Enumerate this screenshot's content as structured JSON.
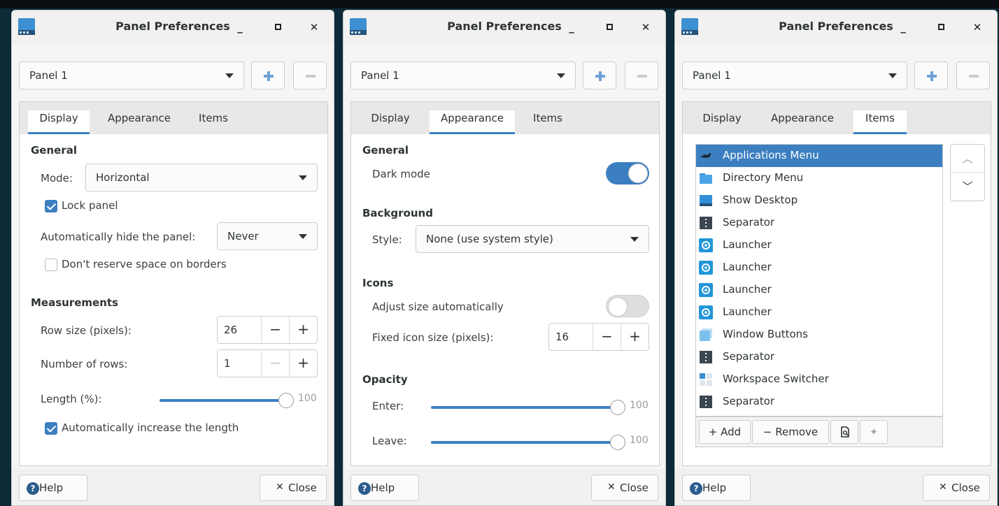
{
  "colors": {
    "accent": "#3c7fc1",
    "window_bg": "#f6f5f4",
    "desktop": "#0c2a38"
  },
  "windows": [
    {
      "title": "Panel Preferences",
      "panel_selected": "Panel 1",
      "tabs": [
        "Display",
        "Appearance",
        "Items"
      ],
      "active_tab": "Display",
      "display": {
        "general_header": "General",
        "mode_label": "Mode:",
        "mode_value": "Horizontal",
        "lock_panel_label": "Lock panel",
        "lock_panel_checked": true,
        "autohide_label": "Automatically hide the panel:",
        "autohide_value": "Never",
        "reserve_label": "Don't reserve space on borders",
        "reserve_checked": false,
        "measurements_header": "Measurements",
        "row_size_label": "Row size (pixels):",
        "row_size_value": "26",
        "rows_label": "Number of rows:",
        "rows_value": "1",
        "length_label": "Length (%):",
        "length_value": "100",
        "auto_length_label": "Automatically increase the length",
        "auto_length_checked": true
      },
      "footer": {
        "help": "Help",
        "close": "Close"
      }
    },
    {
      "title": "Panel Preferences",
      "panel_selected": "Panel 1",
      "tabs": [
        "Display",
        "Appearance",
        "Items"
      ],
      "active_tab": "Appearance",
      "appearance": {
        "general_header": "General",
        "dark_mode_label": "Dark mode",
        "dark_mode_on": true,
        "background_header": "Background",
        "style_label": "Style:",
        "style_value": "None (use system style)",
        "icons_header": "Icons",
        "adjust_label": "Adjust size automatically",
        "adjust_on": false,
        "icon_size_label": "Fixed icon size (pixels):",
        "icon_size_value": "16",
        "opacity_header": "Opacity",
        "enter_label": "Enter:",
        "enter_value": "100",
        "leave_label": "Leave:",
        "leave_value": "100"
      },
      "footer": {
        "help": "Help",
        "close": "Close"
      }
    },
    {
      "title": "Panel Preferences",
      "panel_selected": "Panel 1",
      "tabs": [
        "Display",
        "Appearance",
        "Items"
      ],
      "active_tab": "Items",
      "items": [
        {
          "label": "Applications Menu",
          "icon": "applications-menu-icon",
          "selected": true
        },
        {
          "label": "Directory Menu",
          "icon": "folder-icon"
        },
        {
          "label": "Show Desktop",
          "icon": "show-desktop-icon"
        },
        {
          "label": "Separator",
          "icon": "separator-icon"
        },
        {
          "label": "Launcher",
          "icon": "launcher-icon"
        },
        {
          "label": "Launcher",
          "icon": "launcher-icon"
        },
        {
          "label": "Launcher",
          "icon": "launcher-icon"
        },
        {
          "label": "Launcher",
          "icon": "launcher-icon"
        },
        {
          "label": "Window Buttons",
          "icon": "window-buttons-icon"
        },
        {
          "label": "Separator",
          "icon": "separator-icon"
        },
        {
          "label": "Workspace Switcher",
          "icon": "workspace-switcher-icon"
        },
        {
          "label": "Separator",
          "icon": "separator-icon"
        }
      ],
      "item_tools": {
        "add": "+ Add",
        "remove": "− Remove"
      },
      "footer": {
        "help": "Help",
        "close": "Close"
      }
    }
  ]
}
